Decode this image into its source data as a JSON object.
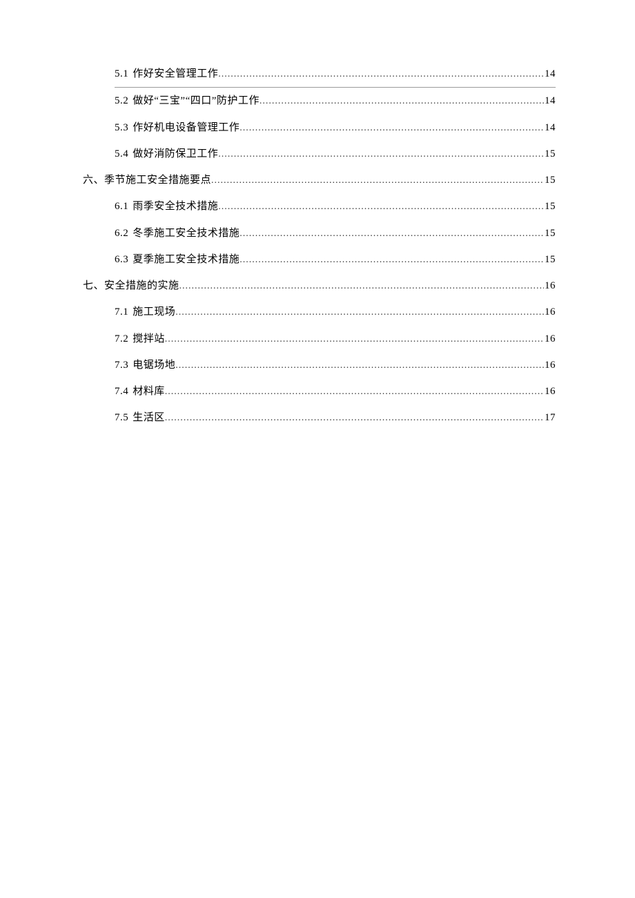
{
  "toc": [
    {
      "level": 2,
      "number": "5.1",
      "title": "作好安全管理工作",
      "page": "14",
      "underlined": true
    },
    {
      "level": 2,
      "number": "5.2",
      "title": "做好“三宝”“四口”防护工作",
      "page": "14",
      "underlined": false
    },
    {
      "level": 2,
      "number": "5.3",
      "title": "作好机电设备管理工作",
      "page": "14",
      "underlined": false
    },
    {
      "level": 2,
      "number": "5.4",
      "title": "做好消防保卫工作",
      "page": "15",
      "underlined": false
    },
    {
      "level": 1,
      "number": "六、",
      "title": "季节施工安全措施要点",
      "page": "15",
      "underlined": false
    },
    {
      "level": 2,
      "number": "6.1",
      "title": "雨季安全技术措施",
      "page": "15",
      "underlined": false
    },
    {
      "level": 2,
      "number": "6.2",
      "title": "冬季施工安全技术措施",
      "page": "15",
      "underlined": false
    },
    {
      "level": 2,
      "number": "6.3",
      "title": "夏季施工安全技术措施",
      "page": "15",
      "underlined": false
    },
    {
      "level": 1,
      "number": "七、",
      "title": "安全措施的实施",
      "page": "16",
      "underlined": false
    },
    {
      "level": 2,
      "number": "7.1",
      "title": "施工现场",
      "page": "16",
      "underlined": false
    },
    {
      "level": 2,
      "number": "7.2",
      "title": "搅拌站",
      "page": "16",
      "underlined": false
    },
    {
      "level": 2,
      "number": "7.3",
      "title": "电锯场地",
      "page": "16",
      "underlined": false
    },
    {
      "level": 2,
      "number": "7.4",
      "title": "材料库",
      "page": "16",
      "underlined": false
    },
    {
      "level": 2,
      "number": "7.5",
      "title": "生活区",
      "page": "17",
      "underlined": false
    }
  ]
}
